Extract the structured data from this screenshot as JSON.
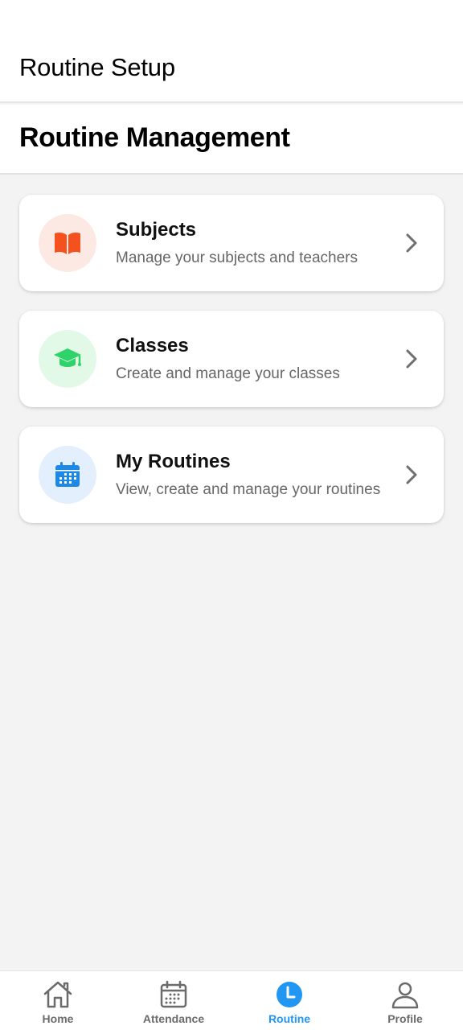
{
  "header": {
    "title": "Routine Setup"
  },
  "section": {
    "heading": "Routine Management"
  },
  "cards": [
    {
      "title": "Subjects",
      "subtitle": "Manage your subjects and teachers",
      "icon": "book-icon",
      "icon_color": "#f4511e",
      "icon_bg": "#fde9e4"
    },
    {
      "title": "Classes",
      "subtitle": "Create and manage your classes",
      "icon": "graduation-cap-icon",
      "icon_color": "#2fd36a",
      "icon_bg": "#e2f9e8"
    },
    {
      "title": "My Routines",
      "subtitle": "View, create and manage your routines",
      "icon": "calendar-icon",
      "icon_color": "#1e88e5",
      "icon_bg": "#e3effc"
    }
  ],
  "bottom_nav": {
    "items": [
      {
        "label": "Home",
        "icon": "home-icon"
      },
      {
        "label": "Attendance",
        "icon": "calendar-icon"
      },
      {
        "label": "Routine",
        "icon": "clock-icon",
        "active": true
      },
      {
        "label": "Profile",
        "icon": "user-icon"
      }
    ],
    "active_color": "#2196f3",
    "inactive_color": "#6b6b6b"
  }
}
